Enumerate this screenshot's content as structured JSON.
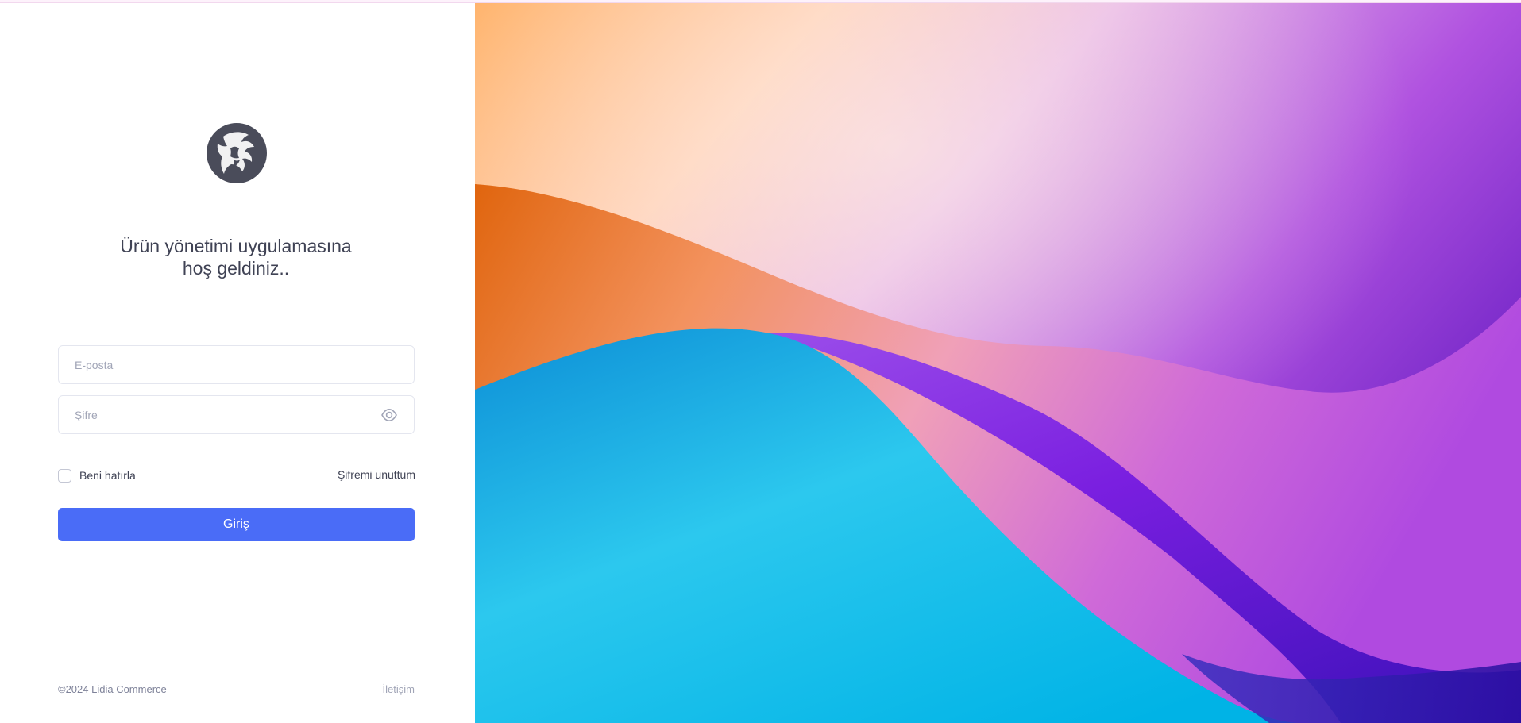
{
  "brand": {
    "logo_icon": "lion-head-icon"
  },
  "welcome": {
    "line1": "Ürün yönetimi uygulamasına",
    "line2": "hoş geldiniz.."
  },
  "form": {
    "email_placeholder": "E-posta",
    "email_value": "",
    "password_placeholder": "Şifre",
    "password_value": "",
    "show_password_icon": "eye-icon",
    "remember_label": "Beni hatırla",
    "remember_checked": false,
    "forgot_label": "Şifremi unuttum",
    "submit_label": "Giriş"
  },
  "footer": {
    "copyright": "©2024 Lidia Commerce",
    "contact_label": "İletişim"
  },
  "colors": {
    "primary": "#4a6cf7",
    "text": "#3f4254",
    "muted": "#a1a5b7",
    "border": "#e4e6ef",
    "art_orange": "#f08a2c",
    "art_purple": "#a338e0",
    "art_cyan": "#1cc2ea"
  }
}
